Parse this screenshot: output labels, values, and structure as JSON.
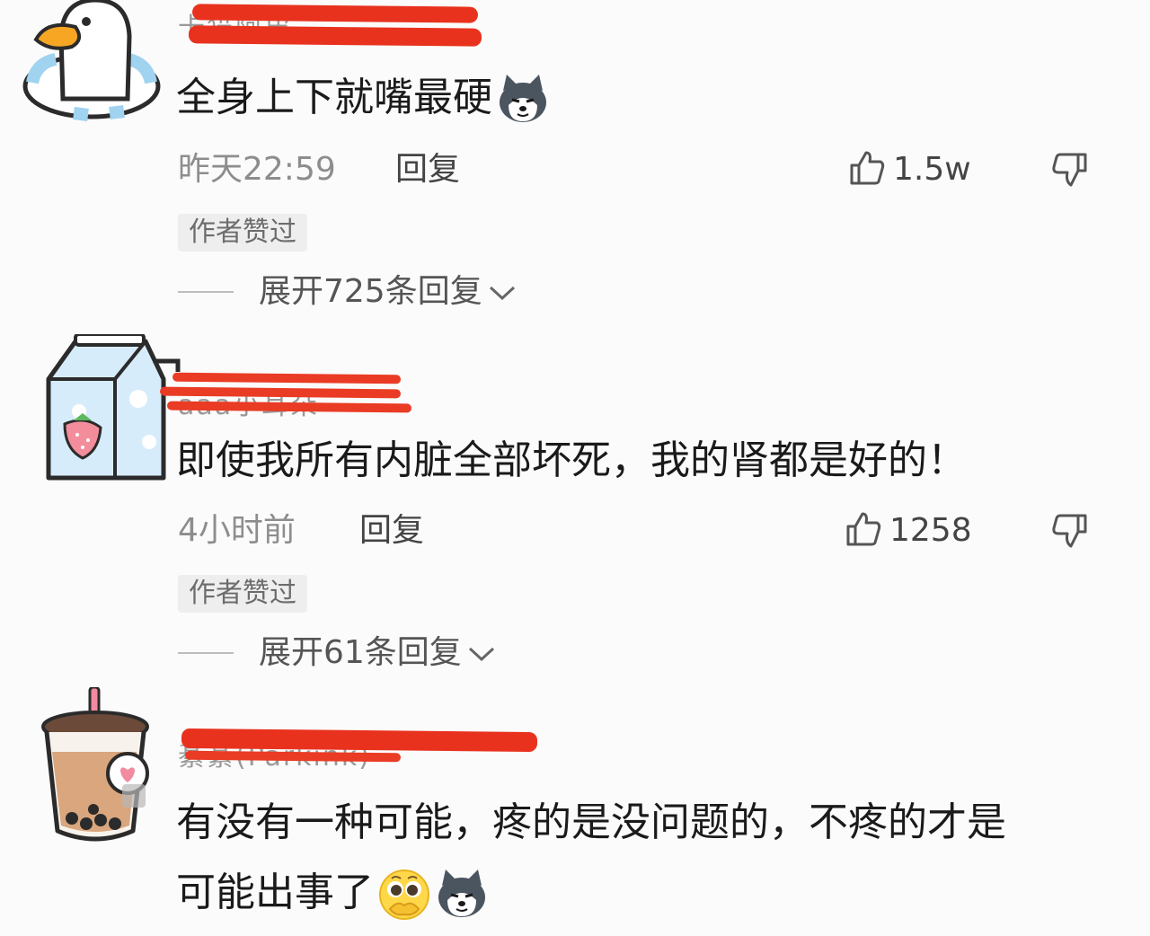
{
  "comments": [
    {
      "username": "卡猫阿皮",
      "text": "全身上下就嘴最硬",
      "time": "昨天22:59",
      "reply_label": "回复",
      "like_count": "1.5w",
      "badge": "作者赞过",
      "expand": "展开725条回复",
      "avatar": "duck-avatar-icon",
      "emojis": [
        "husky-emoji-icon"
      ]
    },
    {
      "username": "aaa小耳朵",
      "text": "即使我所有内脏全部坏死，我的肾都是好的！",
      "time": "4小时前",
      "reply_label": "回复",
      "like_count": "1258",
      "badge": "作者赞过",
      "expand": "展开61条回复",
      "avatar": "milk-carton-avatar-icon",
      "emojis": []
    },
    {
      "username": "綦綦(Parkink)",
      "text_line1": "有没有一种可能，疼的是没问题的，不疼的才是",
      "text_line2": "可能出事了",
      "avatar": "bubble-tea-avatar-icon",
      "emojis": [
        "pleading-face-emoji-icon",
        "husky-emoji-icon"
      ]
    }
  ],
  "colors": {
    "redaction": "#e8321e",
    "text": "#1a1a1a",
    "meta": "#8d8d8d"
  }
}
